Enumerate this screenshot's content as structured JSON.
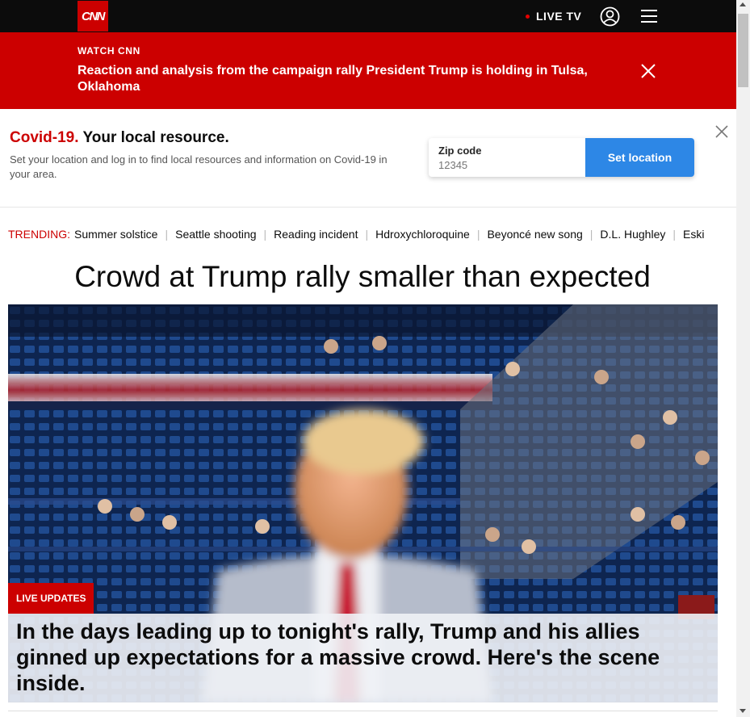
{
  "nav": {
    "logo": "CNN",
    "live_tv": "LIVE TV",
    "user_icon": "user-circle-icon",
    "menu_icon": "hamburger-menu-icon"
  },
  "watch_banner": {
    "kicker": "WATCH CNN",
    "headline": "Reaction and analysis from the campaign rally President Trump is holding in Tulsa, Oklahoma",
    "close_icon": "close-icon"
  },
  "covid": {
    "title_red": "Covid-19.",
    "title_rest": " Your local resource.",
    "description": "Set your location and log in to find local resources and information on Covid-19 in your area.",
    "zip_label": "Zip code",
    "zip_placeholder": "12345",
    "button": "Set location",
    "close_icon": "close-icon"
  },
  "trending": {
    "label": "TRENDING:",
    "items": [
      "Summer solstice",
      "Seattle shooting",
      "Reading incident",
      "Hdroxychloroquine",
      "Beyoncé new song",
      "D.L. Hughley",
      "Eski"
    ]
  },
  "main": {
    "headline": "Crowd at Trump rally smaller than expected",
    "badge": "LIVE UPDATES",
    "caption": "In the days leading up to tonight's rally, Trump and his allies ginned up expectations for a massive crowd. Here's the scene inside."
  },
  "colors": {
    "brand_red": "#cc0000",
    "button_blue": "#2d87e6",
    "nav_black": "#0c0c0c"
  }
}
